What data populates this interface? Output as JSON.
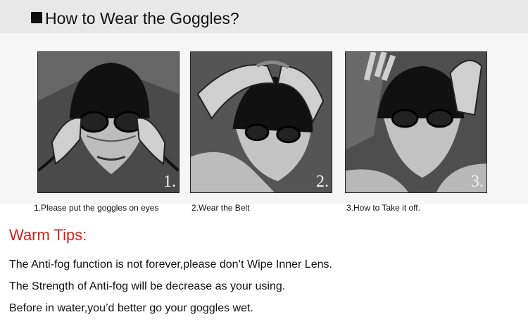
{
  "header": {
    "title": "How to Wear the Goggles?"
  },
  "steps": [
    {
      "number": "1.",
      "caption": "1.Please put the goggles on eyes"
    },
    {
      "number": "2.",
      "caption": "2.Wear the Belt"
    },
    {
      "number": "3.",
      "caption": "3.How to Take it off."
    }
  ],
  "tips": {
    "title": "Warm Tips:",
    "lines": [
      "The Anti-fog function is not forever,please don’t Wipe Inner Lens.",
      "The Strength of Anti-fog will be decrease as your using.",
      "Before in water,you’d better go your goggles wet."
    ]
  },
  "colors": {
    "accent": "#d6201a",
    "header_band": "#e8e8e8"
  }
}
